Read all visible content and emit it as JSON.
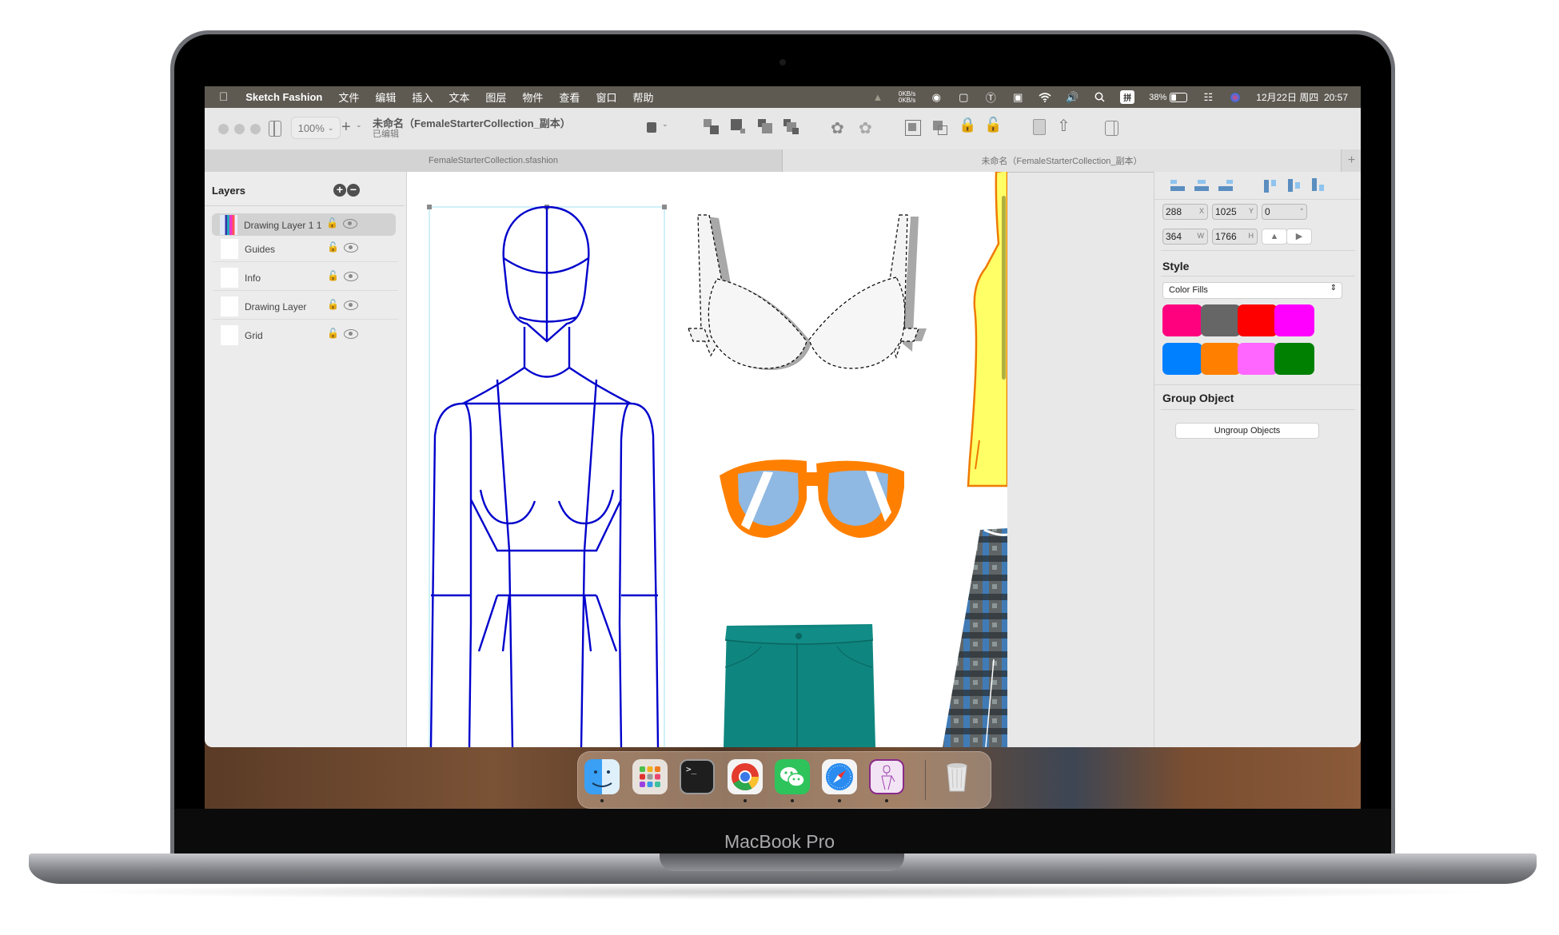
{
  "device": {
    "brand_label": "MacBook Pro"
  },
  "menubar": {
    "app_name": "Sketch Fashion",
    "menus": [
      "文件",
      "编辑",
      "插入",
      "文本",
      "图层",
      "物件",
      "查看",
      "窗口",
      "帮助"
    ],
    "status": {
      "net_up": "0KB/s",
      "net_down": "0KB/s",
      "ime": "拼",
      "battery_percent": "38%",
      "datetime": "12月22日 周四  20:57"
    },
    "icons": [
      "apple-logo",
      "activity-monitor",
      "wechat",
      "screen-share",
      "u-icon",
      "photo",
      "wifi",
      "volume",
      "search",
      "input-method",
      "battery",
      "control-center",
      "siri"
    ]
  },
  "toolbar": {
    "zoom_level": "100%",
    "document_title": "未命名（FemaleStarterCollection_副本）",
    "document_status": "已编辑",
    "tools": [
      "sidebar-toggle",
      "insert",
      "frame",
      "bring-forward",
      "bring-to-front",
      "send-backward",
      "send-to-back",
      "group",
      "ungroup",
      "fit-selection",
      "resize",
      "lock",
      "unlock",
      "export-document",
      "share",
      "inspector-toggle"
    ]
  },
  "tabs": [
    {
      "label": "FemaleStarterCollection.sfashion",
      "active": false
    },
    {
      "label": "未命名（FemaleStarterCollection_副本）",
      "active": true
    }
  ],
  "tab_add_label": "+",
  "layers": {
    "title": "Layers",
    "add_label": "+",
    "remove_label": "−",
    "items": [
      {
        "name": "Drawing Layer 1 1",
        "selected": true
      },
      {
        "name": "Guides",
        "selected": false
      },
      {
        "name": "Info",
        "selected": false
      },
      {
        "name": "Drawing Layer",
        "selected": false
      },
      {
        "name": "Grid",
        "selected": false
      }
    ]
  },
  "inspector": {
    "x": "288",
    "x_unit": "X",
    "y": "1025",
    "y_unit": "Y",
    "rotation": "0",
    "rotation_unit": "°",
    "w": "364",
    "w_unit": "W",
    "h": "1766",
    "h_unit": "H",
    "style_title": "Style",
    "fill_mode": "Color Fills",
    "swatches": [
      "#ff007f",
      "#666666",
      "#ff0000",
      "#ff00ff",
      "#0080ff",
      "#ff8000",
      "#ff66ff",
      "#008000"
    ],
    "group_title": "Group Object",
    "ungroup_label": "Ungroup Objects"
  },
  "canvas": {
    "objects": [
      "croquis-figure",
      "bra",
      "sunglasses",
      "shorts",
      "yellow-top",
      "plaid-skirt"
    ],
    "colors": {
      "croquis": "#0000cc",
      "sunglasses_frame": "#ff8000",
      "sunglasses_lens": "#8fb8e2",
      "shorts": "#0f8a84",
      "top": "#ffff66"
    }
  },
  "dock": {
    "apps": [
      {
        "name": "Finder",
        "running": true
      },
      {
        "name": "Launchpad",
        "running": false
      },
      {
        "name": "Terminal",
        "running": false
      },
      {
        "name": "Chrome",
        "running": true
      },
      {
        "name": "WeChat",
        "running": true
      },
      {
        "name": "Safari",
        "running": true
      },
      {
        "name": "Sketch Fashion",
        "running": true
      },
      {
        "name": "Trash",
        "running": false
      }
    ],
    "terminal_prompt": ">_"
  }
}
